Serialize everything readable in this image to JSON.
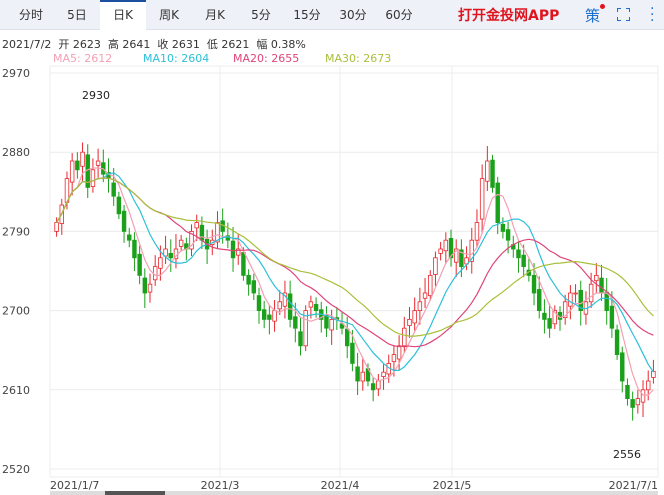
{
  "tabs": [
    "分时",
    "5日",
    "日K",
    "周K",
    "月K",
    "5分",
    "15分",
    "30分",
    "60分"
  ],
  "active_tab": "日K",
  "app_link": "打开金投网APP",
  "strategy_label": "策",
  "info": {
    "date": "2021/7/2",
    "open": "开 2623",
    "high": "高 2641",
    "close": "收 2631",
    "low": "低 2621",
    "change": "幅 0.38%"
  },
  "ma": {
    "ma5": "MA5: 2612",
    "ma10": "MA10: 2604",
    "ma20": "MA20: 2655",
    "ma30": "MA30: 2673"
  },
  "colors": {
    "up": "#e8272d",
    "down": "#1aa01a",
    "ma5": "#f4a0b4",
    "ma10": "#2cc0d8",
    "ma20": "#e0457a",
    "ma30": "#a8c03a",
    "grid": "#ececec"
  },
  "chart_data": {
    "type": "candlestick",
    "ylim": [
      2520,
      2970
    ],
    "yticks": [
      "2970",
      "2880",
      "2790",
      "2700",
      "2610",
      "2520"
    ],
    "xticks": [
      "2021/1/7",
      "2021/3",
      "2021/4",
      "2021/5",
      "2021/7/1"
    ],
    "annotations": {
      "max": "2930",
      "min": "2556"
    },
    "closes": [
      2800,
      2820,
      2850,
      2870,
      2860,
      2880,
      2840,
      2860,
      2870,
      2855,
      2850,
      2830,
      2810,
      2790,
      2780,
      2760,
      2740,
      2720,
      2730,
      2750,
      2760,
      2770,
      2760,
      2770,
      2780,
      2770,
      2790,
      2800,
      2780,
      2770,
      2780,
      2800,
      2790,
      2780,
      2760,
      2770,
      2740,
      2730,
      2720,
      2700,
      2690,
      2690,
      2700,
      2710,
      2720,
      2690,
      2680,
      2660,
      2700,
      2710,
      2700,
      2690,
      2680,
      2690,
      2690,
      2680,
      2660,
      2640,
      2620,
      2630,
      2620,
      2610,
      2620,
      2630,
      2640,
      2650,
      2660,
      2680,
      2690,
      2700,
      2710,
      2720,
      2740,
      2760,
      2770,
      2780,
      2760,
      2770,
      2750,
      2760,
      2780,
      2800,
      2850,
      2870,
      2840,
      2800,
      2790,
      2780,
      2770,
      2760,
      2750,
      2740,
      2720,
      2700,
      2690,
      2680,
      2700,
      2690,
      2710,
      2720,
      2720,
      2700,
      2710,
      2730,
      2740,
      2720,
      2700,
      2680,
      2650,
      2620,
      2600,
      2590,
      2600,
      2610,
      2620,
      2631
    ]
  }
}
